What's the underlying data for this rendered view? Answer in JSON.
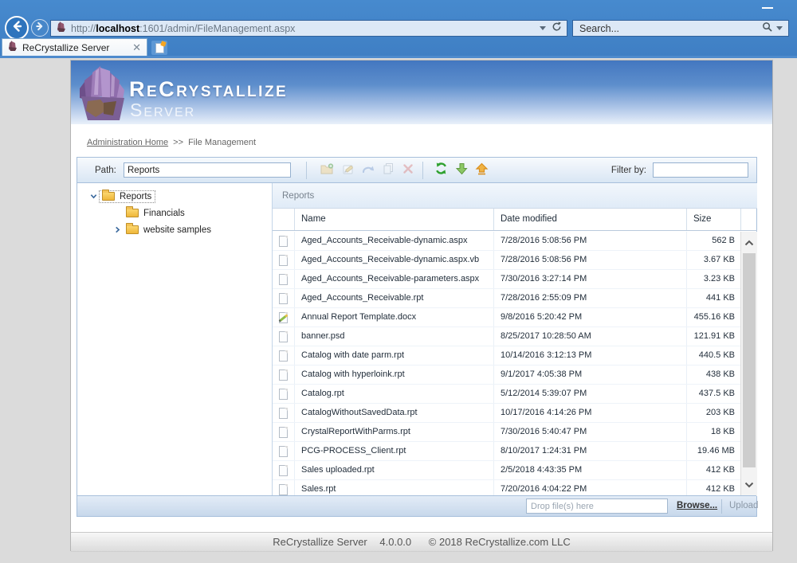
{
  "browser": {
    "url": {
      "protocol": "http://",
      "host": "localhost",
      "path": ":1601/admin/FileManagement.aspx"
    },
    "search": {
      "placeholder": "Search..."
    },
    "tab": {
      "title": "ReCrystallize Server",
      "close_glyph": "✕"
    },
    "icons": [
      "back-icon",
      "forward-icon",
      "crystal-favicon",
      "refresh-icon",
      "dropdown-caret-icon",
      "search-magnifier-icon",
      "minimize-icon",
      "new-tab-icon"
    ]
  },
  "banner": {
    "title": "ReCrystallize",
    "subtitle": "Server"
  },
  "breadcrumb": {
    "home": "Administration Home",
    "separator": ">>",
    "current": "File Management"
  },
  "toolbar": {
    "path_label": "Path:",
    "path_value": "Reports",
    "filter_label": "Filter by:",
    "filter_value": "",
    "icons": [
      "new-folder-icon",
      "rename-icon",
      "undo-icon",
      "copy-icon",
      "delete-icon",
      "refresh-icon",
      "download-icon",
      "upload-icon"
    ],
    "disabled_icons": [
      "new-folder-icon",
      "rename-icon",
      "undo-icon",
      "copy-icon",
      "delete-icon"
    ]
  },
  "tree": {
    "items": [
      {
        "label": "Reports",
        "chevron": "down",
        "level": 0,
        "selected": true
      },
      {
        "label": "Financials",
        "chevron": "none",
        "level": 1,
        "selected": false
      },
      {
        "label": "website samples",
        "chevron": "right",
        "level": 1,
        "selected": false
      }
    ]
  },
  "grid": {
    "panel_title": "Reports",
    "columns": [
      "Name",
      "Date modified",
      "Size"
    ],
    "rows": [
      {
        "icon": "file",
        "name": "Aged_Accounts_Receivable-dynamic.aspx",
        "date": "7/28/2016 5:08:56 PM",
        "size": "562 B"
      },
      {
        "icon": "file",
        "name": "Aged_Accounts_Receivable-dynamic.aspx.vb",
        "date": "7/28/2016 5:08:56 PM",
        "size": "3.67 KB"
      },
      {
        "icon": "file",
        "name": "Aged_Accounts_Receivable-parameters.aspx",
        "date": "7/30/2016 3:27:14 PM",
        "size": "3.23 KB"
      },
      {
        "icon": "file",
        "name": "Aged_Accounts_Receivable.rpt",
        "date": "7/28/2016 2:55:09 PM",
        "size": "441 KB"
      },
      {
        "icon": "docx",
        "name": "Annual Report Template.docx",
        "date": "9/8/2016 5:20:42 PM",
        "size": "455.16 KB"
      },
      {
        "icon": "file",
        "name": "banner.psd",
        "date": "8/25/2017 10:28:50 AM",
        "size": "121.91 KB"
      },
      {
        "icon": "file",
        "name": "Catalog with date parm.rpt",
        "date": "10/14/2016 3:12:13 PM",
        "size": "440.5 KB"
      },
      {
        "icon": "file",
        "name": "Catalog with hyperloink.rpt",
        "date": "9/1/2017 4:05:38 PM",
        "size": "438 KB"
      },
      {
        "icon": "file",
        "name": "Catalog.rpt",
        "date": "5/12/2014 5:39:07 PM",
        "size": "437.5 KB"
      },
      {
        "icon": "file",
        "name": "CatalogWithoutSavedData.rpt",
        "date": "10/17/2016 4:14:26 PM",
        "size": "203 KB"
      },
      {
        "icon": "file",
        "name": "CrystalReportWithParms.rpt",
        "date": "7/30/2016 5:40:47 PM",
        "size": "18 KB"
      },
      {
        "icon": "file",
        "name": "PCG-PROCESS_Client.rpt",
        "date": "8/10/2017 1:24:31 PM",
        "size": "19.46 MB"
      },
      {
        "icon": "file",
        "name": "Sales uploaded.rpt",
        "date": "2/5/2018 4:43:35 PM",
        "size": "412 KB"
      },
      {
        "icon": "file",
        "name": "Sales.rpt",
        "date": "7/20/2016 4:04:22 PM",
        "size": "412 KB"
      }
    ]
  },
  "upload": {
    "placeholder": "Drop file(s) here",
    "browse": "Browse...",
    "upload": "Upload"
  },
  "footer": {
    "product": "ReCrystallize Server",
    "version": "4.0.0.0",
    "copyright": "© 2018 ReCrystallize.com LLC"
  },
  "colors": {
    "chrome_blue": "#4283c6",
    "banner_top_blue": "#4377c0",
    "refresh_green": "#2fa12f",
    "download_green": "#8cc765",
    "upload_orange": "#f0b344",
    "delete_red": "#d98080",
    "folder_yellow": "#f4c355"
  }
}
